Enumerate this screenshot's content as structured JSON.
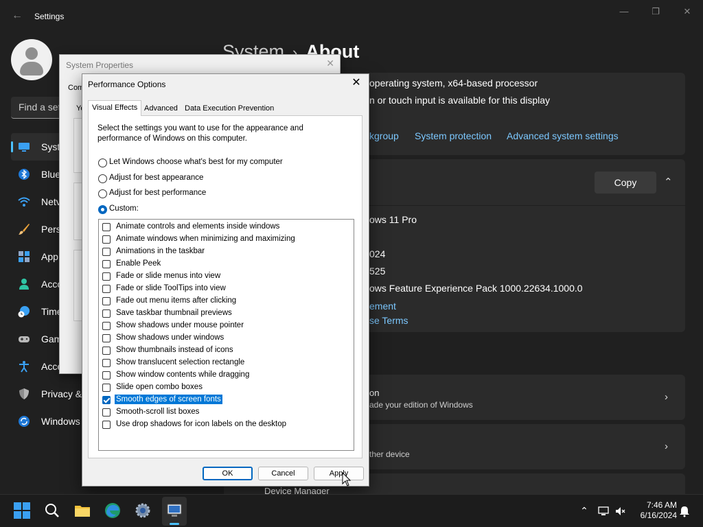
{
  "settings": {
    "app_title": "Settings",
    "search_placeholder": "Find a set",
    "nav": [
      {
        "label": "Syste",
        "icon": "monitor-icon"
      },
      {
        "label": "Blue",
        "icon": "bluetooth-icon"
      },
      {
        "label": "Netv",
        "icon": "wifi-icon"
      },
      {
        "label": "Pers",
        "icon": "brush-icon"
      },
      {
        "label": "App",
        "icon": "apps-icon"
      },
      {
        "label": "Acco",
        "icon": "person-icon"
      },
      {
        "label": "Time",
        "icon": "clock-globe-icon"
      },
      {
        "label": "Gam",
        "icon": "gamepad-icon"
      },
      {
        "label": "Acce",
        "icon": "accessibility-icon"
      },
      {
        "label": "Privacy &",
        "icon": "shield-icon"
      },
      {
        "label": "Windows",
        "icon": "update-icon"
      }
    ],
    "breadcrumb_parent": "System",
    "breadcrumb_separator": "›",
    "page_title": "About",
    "system_type": "operating system, x64-based processor",
    "pen_touch": "n or touch input is available for this display",
    "links": {
      "workgroup": "kgroup",
      "system_protection": "System protection",
      "advanced_system_settings": "Advanced system settings"
    },
    "copy_label": "Copy",
    "windows_spec": {
      "edition": "ows 11 Pro",
      "installed_on": "024",
      "os_build": "525",
      "experience": "ows Feature Experience Pack 1000.22634.1000.0",
      "link_agreement": "ement",
      "link_license": "se Terms"
    },
    "related": {
      "product_key_title": "on",
      "product_key_sub": "ade your edition of Windows",
      "remote_sub": "ther device",
      "device_manager": "Device Manager"
    }
  },
  "system_properties": {
    "title": "System Properties",
    "fragment_tab": "Com",
    "fragment_yo": "Yo"
  },
  "perf_dialog": {
    "title": "Performance Options",
    "tabs": [
      "Visual Effects",
      "Advanced",
      "Data Execution Prevention"
    ],
    "description": "Select the settings you want to use for the appearance and performance of Windows on this computer.",
    "radios": [
      {
        "label": "Let Windows choose what's best for my computer",
        "checked": false
      },
      {
        "label": "Adjust for best appearance",
        "checked": false
      },
      {
        "label": "Adjust for best performance",
        "checked": false
      },
      {
        "label": "Custom:",
        "checked": true
      }
    ],
    "effects": [
      {
        "label": "Animate controls and elements inside windows",
        "checked": false
      },
      {
        "label": "Animate windows when minimizing and maximizing",
        "checked": false
      },
      {
        "label": "Animations in the taskbar",
        "checked": false
      },
      {
        "label": "Enable Peek",
        "checked": false
      },
      {
        "label": "Fade or slide menus into view",
        "checked": false
      },
      {
        "label": "Fade or slide ToolTips into view",
        "checked": false
      },
      {
        "label": "Fade out menu items after clicking",
        "checked": false
      },
      {
        "label": "Save taskbar thumbnail previews",
        "checked": false
      },
      {
        "label": "Show shadows under mouse pointer",
        "checked": false
      },
      {
        "label": "Show shadows under windows",
        "checked": false
      },
      {
        "label": "Show thumbnails instead of icons",
        "checked": false
      },
      {
        "label": "Show translucent selection rectangle",
        "checked": false
      },
      {
        "label": "Show window contents while dragging",
        "checked": false
      },
      {
        "label": "Slide open combo boxes",
        "checked": false
      },
      {
        "label": "Smooth edges of screen fonts",
        "checked": true,
        "selected": true
      },
      {
        "label": "Smooth-scroll list boxes",
        "checked": false
      },
      {
        "label": "Use drop shadows for icon labels on the desktop",
        "checked": false
      }
    ],
    "buttons": {
      "ok": "OK",
      "cancel": "Cancel",
      "apply": "Apply"
    }
  },
  "taskbar": {
    "time": "7:46 AM",
    "date": "6/16/2024",
    "apps": [
      "start-icon",
      "search-icon",
      "file-explorer-icon",
      "edge-icon",
      "settings-icon",
      "system-properties-icon"
    ]
  },
  "colors": {
    "accent": "#4cc2ff",
    "link": "#7cc8ff",
    "selection": "#0078d7",
    "button_focus": "#0067c0"
  }
}
